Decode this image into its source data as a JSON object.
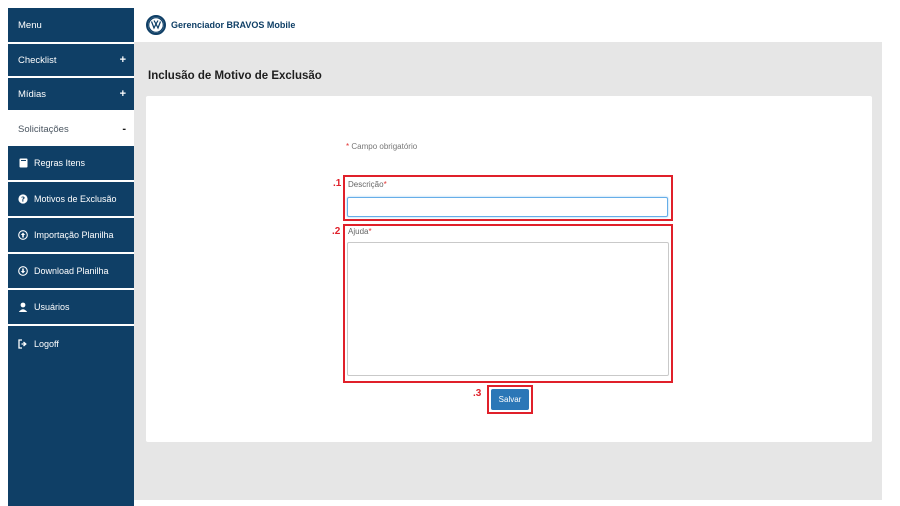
{
  "sidebar": {
    "menu_label": "Menu",
    "groups": [
      {
        "label": "Checklist",
        "sign": "+"
      },
      {
        "label": "Mídias",
        "sign": "+"
      },
      {
        "label": "Solicitações",
        "sign": "-"
      }
    ],
    "items": [
      {
        "label": "Regras Itens",
        "icon": "book-icon"
      },
      {
        "label": "Motivos de Exclusão",
        "icon": "question-circle-icon"
      },
      {
        "label": "Importação Planilha",
        "icon": "upload-circle-icon"
      },
      {
        "label": "Download Planilha",
        "icon": "download-circle-icon"
      },
      {
        "label": "Usuários",
        "icon": "user-icon"
      },
      {
        "label": "Logoff",
        "icon": "logout-icon"
      }
    ]
  },
  "header": {
    "logo_icon": "vw-logo-icon",
    "app_title": "Gerenciador BRAVOS Mobile"
  },
  "main": {
    "page_title": "Inclusão de Motivo de Exclusão",
    "required_note": "Campo obrigatório",
    "required_mark": "*",
    "fields": {
      "description_label": "Descrição",
      "description_value": "",
      "help_label": "Ajuda",
      "help_value": ""
    },
    "markers": [
      ".1",
      ".2",
      ".3"
    ],
    "save_label": "Salvar"
  },
  "colors": {
    "sidebar_bg": "#0f3f66",
    "content_bg": "#e6e6e6",
    "annotation_red": "#e0202a",
    "button_blue": "#2b77b7"
  }
}
